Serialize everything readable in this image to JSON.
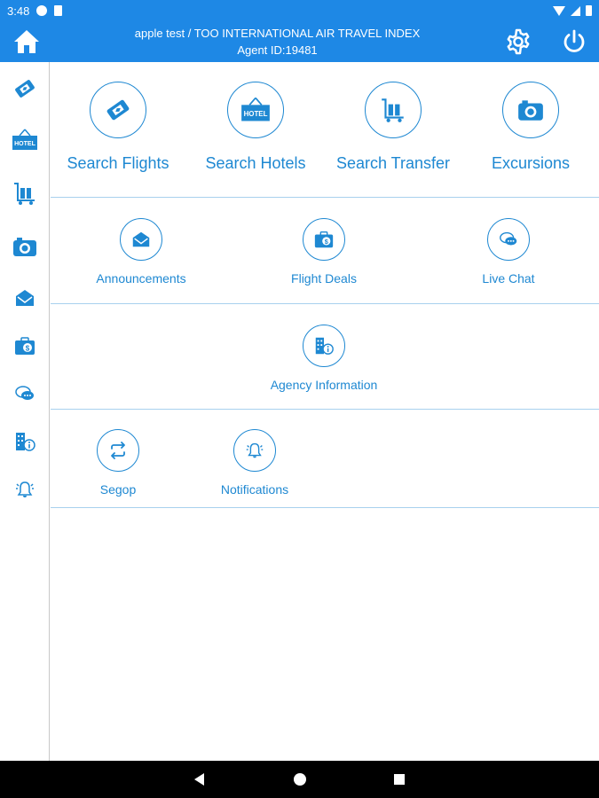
{
  "status_bar": {
    "time": "3:48"
  },
  "header": {
    "title_line1": "apple test / TOO INTERNATIONAL AIR TRAVEL INDEX",
    "title_line2": "Agent ID:19481"
  },
  "tiles_row1": [
    {
      "label": "Search Flights",
      "icon": "ticket-icon"
    },
    {
      "label": "Search Hotels",
      "icon": "hotel-sign-icon"
    },
    {
      "label": "Search Transfer",
      "icon": "luggage-cart-icon"
    },
    {
      "label": "Excursions",
      "icon": "camera-icon"
    }
  ],
  "tiles_row2": [
    {
      "label": "Announcements",
      "icon": "envelope-icon"
    },
    {
      "label": "Flight Deals",
      "icon": "suitcase-dollar-icon"
    },
    {
      "label": "Live Chat",
      "icon": "chat-bubbles-icon"
    }
  ],
  "tiles_row3": [
    {
      "label": "Agency Information",
      "icon": "building-info-icon"
    }
  ],
  "tiles_row4": [
    {
      "label": "Segop",
      "icon": "swap-arrows-icon"
    },
    {
      "label": "Notifications",
      "icon": "bell-icon"
    }
  ],
  "hotel_sign_text": "HOTEL",
  "colors": {
    "primary": "#1e88e5",
    "icon": "#1e88d2",
    "divider": "#a8d1ee"
  }
}
